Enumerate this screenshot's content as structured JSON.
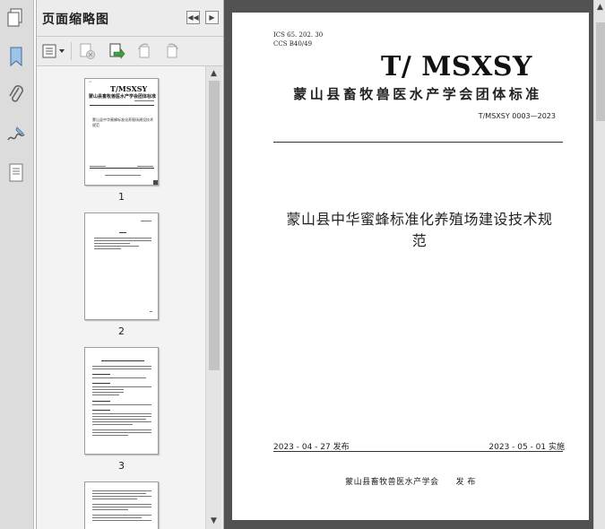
{
  "rail": {
    "icons": [
      "page-thumbnails-icon",
      "bookmark-icon",
      "attachment-icon",
      "signature-icon",
      "layers-icon"
    ]
  },
  "thumbnails_panel": {
    "title": "页面缩略图",
    "toolbar_icons": [
      "options-menu-icon",
      "delete-page-icon",
      "insert-page-icon",
      "rotate-ccw-icon",
      "rotate-cw-icon"
    ],
    "thumbnails": [
      {
        "page_label": "1",
        "selected": true,
        "preview": {
          "brand": "T/MSXSY",
          "org": "蒙山县畜牧兽医水产学会团体标准",
          "title": "蒙山县中华蜜蜂标准化养殖场建设技术规范"
        }
      },
      {
        "page_label": "2",
        "selected": false
      },
      {
        "page_label": "3",
        "selected": false
      },
      {
        "page_label": "",
        "selected": false
      }
    ]
  },
  "document": {
    "ics": "ICS  65. 202. 30",
    "ccs": "CCS  B40/49",
    "brand": "T/ MSXSY",
    "org": "蒙山县畜牧兽医水产学会团体标准",
    "standard_no": "T/MSXSY 0003—2023",
    "title_line1": "蒙山县中华蜜蜂标准化养殖场建设技术规",
    "title_line2": "范",
    "published": "2023 - 04 - 27 发布",
    "implemented": "2023 - 05 - 01 实施",
    "issuer": "蒙山县畜牧兽医水产学会　　发  布"
  },
  "colors": {
    "document_background": "#525252",
    "panel_background": "#ececec",
    "page": "#ffffff"
  }
}
